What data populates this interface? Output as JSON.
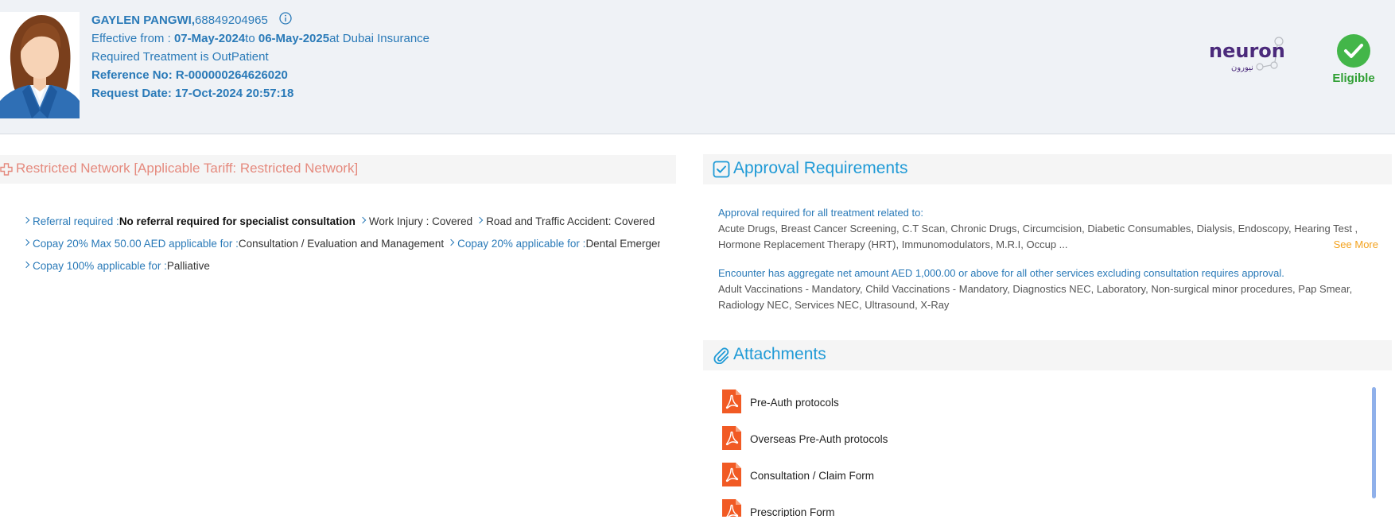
{
  "header": {
    "patient_name": "GAYLEN PANGWI,",
    "member_id": "68849204965",
    "effective_prefix": "Effective from : ",
    "effective_start": "07-May-2024",
    "effective_to_word": "to ",
    "effective_end": "06-May-2025",
    "effective_at": "at Dubai Insurance",
    "treatment": "Required Treatment is OutPatient",
    "reference": "Reference No: R-000000264626020",
    "request_date": "Request Date: 17-Oct-2024 20:57:18",
    "logo_text": "neuron",
    "logo_subtext": "نيورون",
    "eligibility": "Eligible",
    "colors": {
      "eligible": "#2f9f33",
      "link": "#2a7ab8"
    }
  },
  "network": {
    "title": "Restricted Network [Applicable Tariff: Restricted Network]",
    "benefits": [
      [
        {
          "label": "Referral required :",
          "value": "No referral required for specialist consultation",
          "strong": true
        },
        {
          "label": "",
          "value": "Work Injury : Covered"
        },
        {
          "label": "",
          "value": "Road and Traffic Accident: Covered"
        }
      ],
      [
        {
          "label": "Copay 20% Max 50.00 AED applicable for :",
          "value": "Consultation / Evaluation and Management"
        },
        {
          "label": "Copay 20% applicable for :",
          "value": "Dental Emergency"
        }
      ],
      [
        {
          "label": "Copay 100% applicable for :",
          "value": "Palliative"
        }
      ]
    ]
  },
  "approval": {
    "title": "Approval Requirements",
    "group1_heading": "Approval required for all treatment related to:",
    "group1_text": "Acute Drugs, Breast Cancer Screening, C.T Scan, Chronic Drugs, Circumcision, Diabetic Consumables, Dialysis, Endoscopy, Hearing Test , Hormone Replacement Therapy (HRT), Immunomodulators, M.R.I, Occup ...",
    "see_more": "See More",
    "group2_heading": "Encounter has aggregate net amount AED 1,000.00 or above for all other services excluding consultation requires approval.",
    "group2_text": "Adult Vaccinations - Mandatory, Child Vaccinations - Mandatory, Diagnostics NEC, Laboratory, Non-surgical minor procedures, Pap Smear, Radiology NEC, Services NEC, Ultrasound, X-Ray"
  },
  "attachments": {
    "title": "Attachments",
    "items": [
      {
        "name": "Pre-Auth protocols"
      },
      {
        "name": "Overseas Pre-Auth protocols"
      },
      {
        "name": "Consultation / Claim Form"
      },
      {
        "name": "Prescription Form"
      }
    ]
  }
}
